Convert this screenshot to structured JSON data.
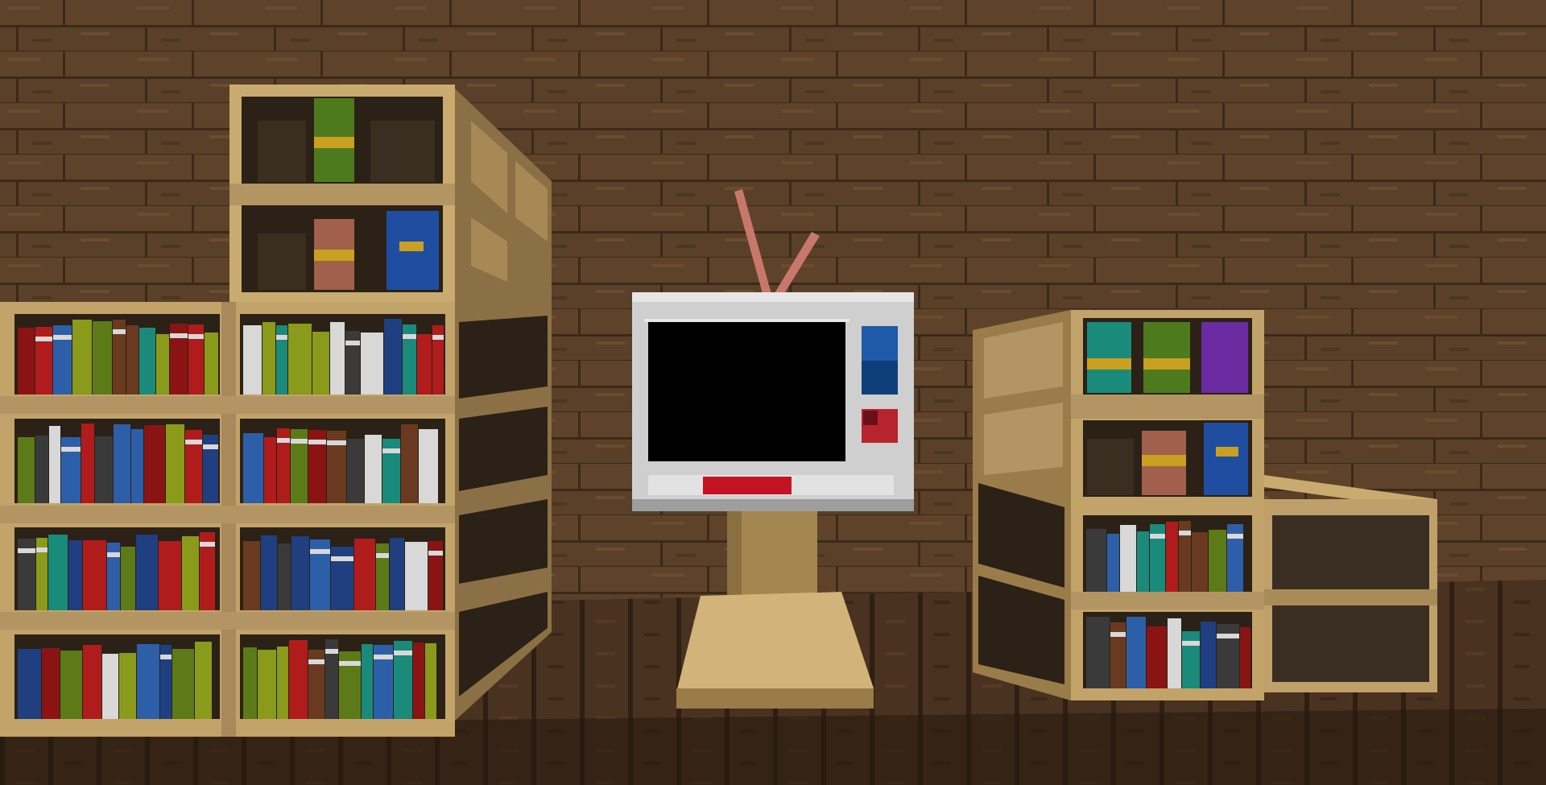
{
  "scene": {
    "description_name": "minecraft-room",
    "palette": {
      "wall": "#5a4028",
      "wall_dark": "#3e2c1b",
      "floor": "#4a3220",
      "floor_dark": "#2e1f13",
      "plank_light": "#c8a96e",
      "plank_mid": "#a88a55",
      "plank_dark": "#7d6440",
      "shelf_back": "#2b2116",
      "tv_body": "#cfcfcf",
      "tv_screen": "#000000",
      "tv_red": "#c41423",
      "tv_blue": "#1e5aa8",
      "antenna": "#c8786a"
    },
    "book_colors": [
      "#b01c1c",
      "#8a1414",
      "#2d5fa8",
      "#1f3f80",
      "#8a9a1a",
      "#5c7a18",
      "#1a8a7a",
      "#d8d8d8",
      "#3a3a3a",
      "#6a3a20"
    ]
  }
}
